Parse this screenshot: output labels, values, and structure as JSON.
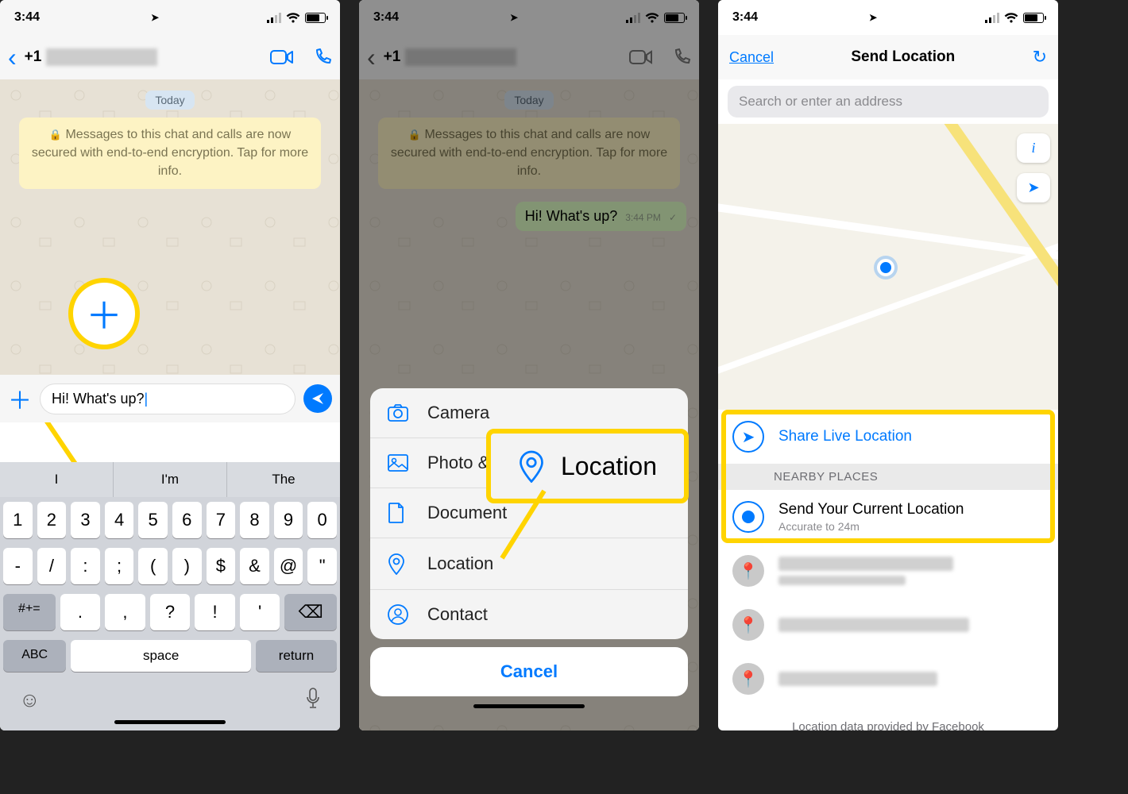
{
  "status": {
    "time": "3:44"
  },
  "screen1": {
    "contact_prefix": "+1",
    "day_label": "Today",
    "encryption": "Messages to this chat and calls are now secured with end-to-end encryption. Tap for more info.",
    "compose_value": "Hi! What's up?",
    "suggestions": [
      "I",
      "I'm",
      "The"
    ],
    "row_num": [
      "1",
      "2",
      "3",
      "4",
      "5",
      "6",
      "7",
      "8",
      "9",
      "0"
    ],
    "row_sym": [
      "-",
      "/",
      ":",
      ";",
      "(",
      ")",
      "$",
      "&",
      "@",
      "\""
    ],
    "row_sym2": [
      "#+=",
      ".",
      ",",
      "?",
      "!",
      "'",
      "⌫"
    ],
    "row_bot": [
      "ABC",
      "space",
      "return"
    ]
  },
  "screen2": {
    "contact_prefix": "+1",
    "day_label": "Today",
    "encryption": "Messages to this chat and calls are now secured with end-to-end encryption. Tap for more info.",
    "msg_text": "Hi! What's up?",
    "msg_time": "3:44 PM",
    "sheet": {
      "camera": "Camera",
      "photo": "Photo & Video Library",
      "document": "Document",
      "location": "Location",
      "contact": "Contact",
      "cancel": "Cancel"
    },
    "callout_label": "Location"
  },
  "screen3": {
    "cancel": "Cancel",
    "title": "Send Location",
    "search_placeholder": "Search or enter an address",
    "share_live": "Share Live Location",
    "nearby_header": "NEARBY PLACES",
    "send_current": "Send Your Current Location",
    "accuracy": "Accurate to 24m",
    "footer": "Location data provided by Facebook"
  }
}
